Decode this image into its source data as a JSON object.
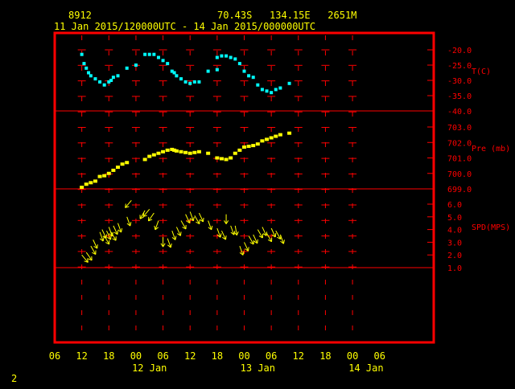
{
  "header": {
    "station_id": "8912",
    "location": "70.43S   134.15E   2651M",
    "time_range": "11 Jan 2015/120000UTC - 14 Jan 2015/000000UTC"
  },
  "footer": {
    "page_number": "2"
  },
  "colors": {
    "frame": "#ff0000",
    "grid": "#ff0000",
    "temperature": "#00ffff",
    "pressure": "#ffff00",
    "wind": "#ffff00",
    "header_text": "#ffff00",
    "background": "#000000"
  },
  "chart_data": {
    "type": "scatter",
    "x_axis": {
      "unit": "hours since 11 Jan 06 UTC",
      "range": [
        0,
        84
      ],
      "tick_labels": [
        "06",
        "12",
        "18",
        "00",
        "06",
        "12",
        "18",
        "00",
        "06",
        "12",
        "18",
        "00",
        "06"
      ],
      "date_labels": [
        {
          "text": "12 Jan",
          "x": 21
        },
        {
          "text": "13 Jan",
          "x": 45
        },
        {
          "text": "14 Jan",
          "x": 69
        }
      ]
    },
    "panels": [
      {
        "name": "temperature",
        "label": "T(C)",
        "ticks": [
          "-20.0",
          "-25.0",
          "-30.0",
          "-35.0",
          "-40.0"
        ],
        "range": [
          -40,
          -20
        ],
        "points": [
          [
            6,
            -21.5
          ],
          [
            6.5,
            -24.5
          ],
          [
            7,
            -26
          ],
          [
            7.5,
            -27.5
          ],
          [
            8,
            -28.5
          ],
          [
            9,
            -29.5
          ],
          [
            10,
            -30.5
          ],
          [
            11,
            -31.5
          ],
          [
            12,
            -30.5
          ],
          [
            12.5,
            -30
          ],
          [
            13,
            -29
          ],
          [
            14,
            -28.5
          ],
          [
            16,
            -26
          ],
          [
            18,
            -25
          ],
          [
            20,
            -21.5
          ],
          [
            21,
            -21.5
          ],
          [
            22,
            -21.5
          ],
          [
            23,
            -22.5
          ],
          [
            24,
            -23.5
          ],
          [
            25,
            -24.5
          ],
          [
            26,
            -27
          ],
          [
            26.5,
            -27.5
          ],
          [
            27,
            -28.5
          ],
          [
            28,
            -29.5
          ],
          [
            29,
            -30.5
          ],
          [
            30,
            -31
          ],
          [
            31,
            -30.5
          ],
          [
            32,
            -30.5
          ],
          [
            34,
            -27
          ],
          [
            36,
            -22.5
          ],
          [
            37,
            -22
          ],
          [
            38,
            -22
          ],
          [
            39,
            -22.5
          ],
          [
            40,
            -23
          ],
          [
            41,
            -24.5
          ],
          [
            42,
            -27
          ],
          [
            43,
            -28.5
          ],
          [
            44,
            -29
          ],
          [
            45,
            -31.5
          ],
          [
            46,
            -33
          ],
          [
            47,
            -33.5
          ],
          [
            48,
            -34
          ],
          [
            49,
            -33
          ],
          [
            50,
            -32.5
          ],
          [
            52,
            -31
          ],
          [
            36,
            -26.5
          ]
        ]
      },
      {
        "name": "pressure",
        "label": "Pre (mb)",
        "ticks": [
          "703.0",
          "702.0",
          "701.0",
          "700.0",
          "699.0"
        ],
        "range": [
          699,
          703
        ],
        "points": [
          [
            6,
            699.1
          ],
          [
            7,
            699.3
          ],
          [
            8,
            699.4
          ],
          [
            9,
            699.5
          ],
          [
            10,
            699.8
          ],
          [
            11,
            699.85
          ],
          [
            12,
            700
          ],
          [
            13,
            700.2
          ],
          [
            14,
            700.4
          ],
          [
            15,
            700.6
          ],
          [
            16,
            700.7
          ],
          [
            20,
            700.9
          ],
          [
            21,
            701.1
          ],
          [
            22,
            701.2
          ],
          [
            23,
            701.3
          ],
          [
            24,
            701.4
          ],
          [
            25,
            701.5
          ],
          [
            26,
            701.55
          ],
          [
            26.5,
            701.5
          ],
          [
            27,
            701.45
          ],
          [
            28,
            701.4
          ],
          [
            29,
            701.35
          ],
          [
            30,
            701.3
          ],
          [
            31,
            701.35
          ],
          [
            32,
            701.4
          ],
          [
            34,
            701.3
          ],
          [
            36,
            701.0
          ],
          [
            37,
            700.95
          ],
          [
            38,
            700.9
          ],
          [
            39,
            701.0
          ],
          [
            40,
            701.3
          ],
          [
            41,
            701.5
          ],
          [
            42,
            701.7
          ],
          [
            43,
            701.75
          ],
          [
            44,
            701.8
          ],
          [
            45,
            701.9
          ],
          [
            46,
            702.1
          ],
          [
            47,
            702.2
          ],
          [
            48,
            702.3
          ],
          [
            49,
            702.4
          ],
          [
            50,
            702.5
          ],
          [
            52,
            702.6
          ]
        ]
      },
      {
        "name": "wind_speed",
        "label": "SPD(MPS)",
        "ticks": [
          "6.0",
          "5.0",
          "4.0",
          "3.0",
          "2.0",
          "1.0"
        ],
        "range": [
          0,
          7
        ],
        "points": [
          [
            6,
            2.0,
            220
          ],
          [
            7,
            2.2,
            215
          ],
          [
            8,
            2.7,
            210
          ],
          [
            8.5,
            3.2,
            205
          ],
          [
            10,
            3.8,
            200
          ],
          [
            10.5,
            4.0,
            205
          ],
          [
            11,
            3.5,
            210
          ],
          [
            11.5,
            3.9,
            205
          ],
          [
            12,
            4.2,
            200
          ],
          [
            12.5,
            3.8,
            210
          ],
          [
            13,
            4.3,
            205
          ],
          [
            14,
            4.5,
            200
          ],
          [
            16,
            5.0,
            200
          ],
          [
            17,
            6.3,
            140
          ],
          [
            20,
            5.5,
            150
          ],
          [
            21,
            5.6,
            140
          ],
          [
            22,
            5.3,
            145
          ],
          [
            23,
            4.7,
            160
          ],
          [
            24,
            3.4,
            180
          ],
          [
            25,
            3.3,
            200
          ],
          [
            26,
            3.9,
            200
          ],
          [
            27,
            4.2,
            205
          ],
          [
            28,
            4.7,
            210
          ],
          [
            29,
            5.2,
            205
          ],
          [
            30,
            5.4,
            200
          ],
          [
            31,
            5.1,
            210
          ],
          [
            32,
            5.3,
            205
          ],
          [
            34,
            4.7,
            200
          ],
          [
            36,
            4.1,
            200
          ],
          [
            37,
            3.9,
            205
          ],
          [
            38,
            5.2,
            180
          ],
          [
            39,
            4.3,
            200
          ],
          [
            40,
            4.3,
            190
          ],
          [
            41,
            2.7,
            200
          ],
          [
            42,
            3.0,
            205
          ],
          [
            43,
            3.5,
            210
          ],
          [
            44,
            3.6,
            205
          ],
          [
            45,
            4.0,
            210
          ],
          [
            46,
            4.2,
            205
          ],
          [
            47,
            3.7,
            210
          ],
          [
            48,
            4.1,
            205
          ],
          [
            49,
            3.9,
            210
          ],
          [
            50,
            3.6,
            200
          ]
        ]
      }
    ]
  }
}
